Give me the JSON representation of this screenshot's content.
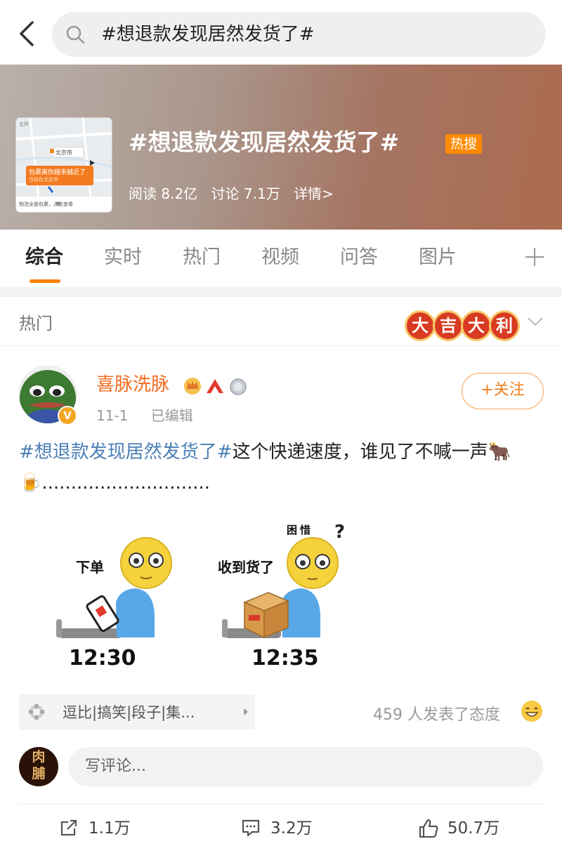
{
  "search": {
    "query": "#想退款发现居然发货了#"
  },
  "topic": {
    "title": "#想退款发现居然发货了#",
    "badge": "热搜",
    "reads": "阅读 8.2亿",
    "discussions": "讨论 7.1万",
    "details": "详情>",
    "thumbnail": {
      "map_label_1": "北京市",
      "notice_line1": "包裹离你越来越近了",
      "notice_line2": "当前在北京市",
      "footer_left": "物流全部包裹，点击查看",
      "map_top_left": "五环"
    }
  },
  "tabs": [
    "综合",
    "实时",
    "热门",
    "视频",
    "问答",
    "图片"
  ],
  "section": {
    "label": "热门",
    "lucky_chars": [
      "大",
      "吉",
      "大",
      "利"
    ]
  },
  "post": {
    "username": "喜脉洗脉",
    "vip_mark": "V",
    "date": "11-1",
    "edited": "已编辑",
    "follow_label": "+关注",
    "hashtag": "#想退款发现居然发货了#",
    "body": "这个快递速度，谁见了不喊一声🐂🍺.............................",
    "meme": {
      "left_caption": "下单",
      "left_time": "12:30",
      "right_caption": "收到货了",
      "right_time": "12:35",
      "confused": "困惜"
    },
    "tags": "逗比|搞笑|段子|集...",
    "reactions": "459 人发表了态度",
    "comment_placeholder": "写评论...",
    "commenter_avatar_text": "肉脯",
    "reposts": "1.1万",
    "comments": "3.2万",
    "likes": "50.7万"
  },
  "colors": {
    "accent": "#ff8200",
    "username": "#f36b20",
    "hashtag": "#4a7fb5"
  }
}
